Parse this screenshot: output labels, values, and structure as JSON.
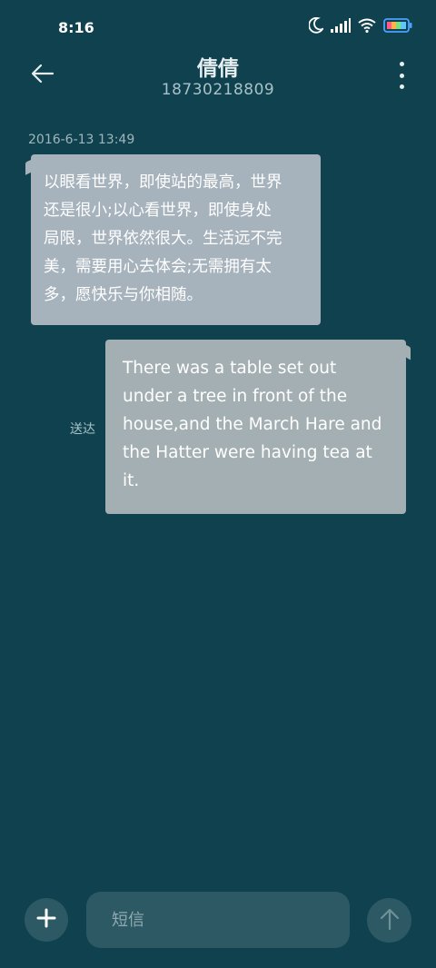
{
  "status_bar": {
    "time": "8:16",
    "icons": [
      "moon-icon",
      "signal-icon",
      "wifi-icon",
      "battery-icon"
    ]
  },
  "header": {
    "contact_name": "倩倩",
    "contact_number": "18730218809",
    "back_icon": "arrow-left-icon",
    "more_icon": "more-vertical-icon"
  },
  "conversation": {
    "timestamp": "2016-6-13 13:49",
    "messages": [
      {
        "direction": "incoming",
        "lines": [
          "以眼看世界，即使站的最高，世界",
          "还是很小;以心看世界，即使身处",
          "局限，世界依然很大。生活远不完",
          "美，需要用心去体会;无需拥有太",
          "多，愿快乐与你相随。"
        ]
      },
      {
        "direction": "outgoing",
        "lines": [
          "There was a table set out",
          "under a tree in front of the",
          "house,and the March Hare and",
          "the Hatter were having tea at",
          "it."
        ],
        "status": "送达"
      }
    ]
  },
  "composer": {
    "placeholder": "短信",
    "add_icon": "plus-icon",
    "send_icon": "arrow-up-icon"
  },
  "colors": {
    "background": "#0f414e",
    "incoming_bubble": "#a6b2bc",
    "outgoing_bubble": "#a3afb2",
    "control": "#2c5963"
  }
}
